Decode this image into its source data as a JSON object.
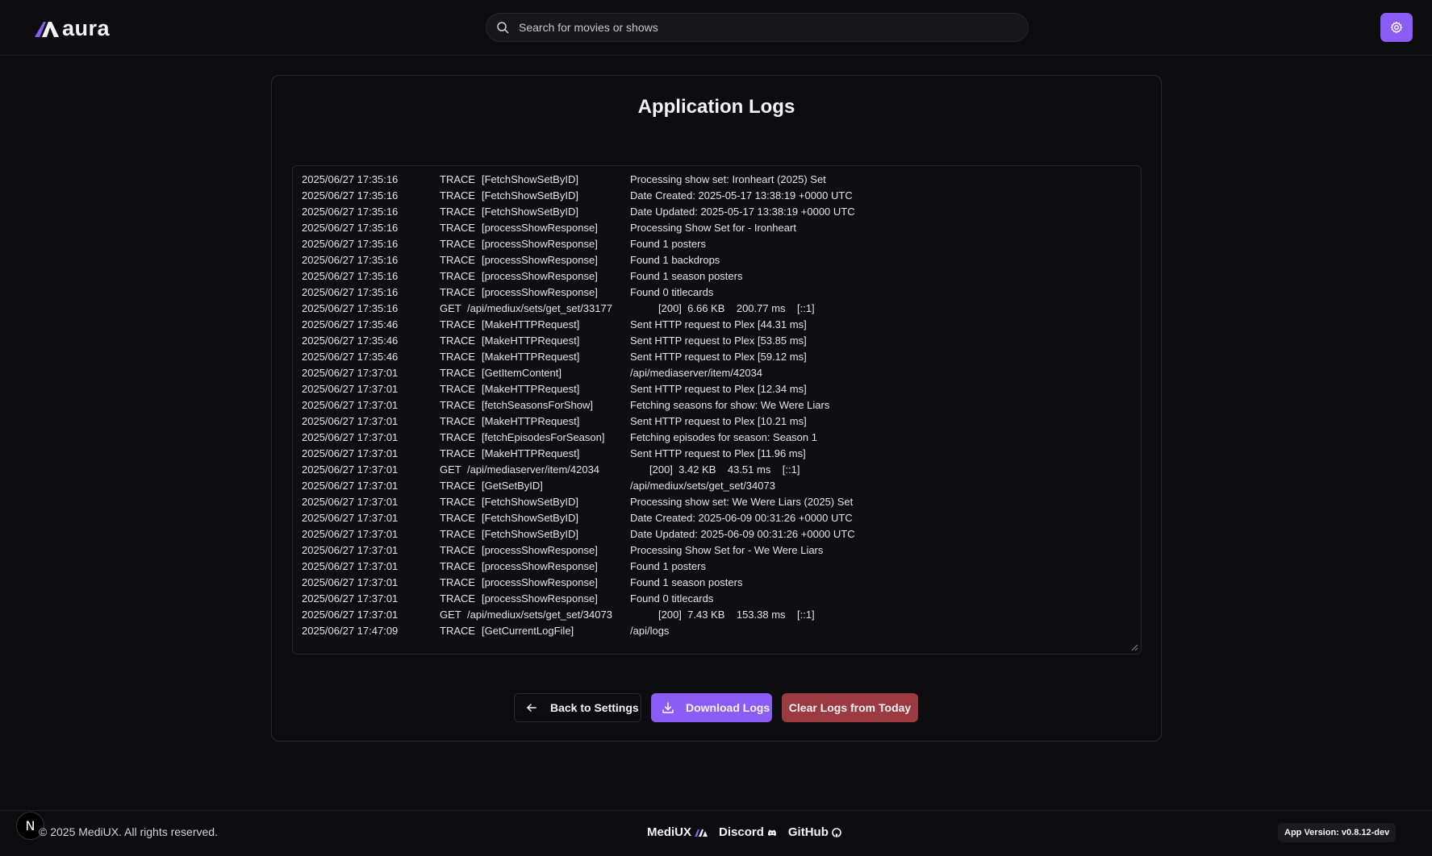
{
  "app": {
    "name": "aura",
    "accent_color": "#8b5cf6",
    "danger_color": "#9b3a40"
  },
  "search": {
    "placeholder": "Search for movies or shows"
  },
  "page": {
    "title": "Application Logs"
  },
  "logs": [
    {
      "ts": "2025/06/27 17:35:16",
      "level": "TRACE",
      "source": "[FetchShowSetByID]",
      "message": "Processing show set: Ironheart (2025) Set"
    },
    {
      "ts": "2025/06/27 17:35:16",
      "level": "TRACE",
      "source": "[FetchShowSetByID]",
      "message": "Date Created: 2025-05-17 13:38:19 +0000 UTC"
    },
    {
      "ts": "2025/06/27 17:35:16",
      "level": "TRACE",
      "source": "[FetchShowSetByID]",
      "message": "Date Updated: 2025-05-17 13:38:19 +0000 UTC"
    },
    {
      "ts": "2025/06/27 17:35:16",
      "level": "TRACE",
      "source": "[processShowResponse]",
      "message": "Processing Show Set for - Ironheart"
    },
    {
      "ts": "2025/06/27 17:35:16",
      "level": "TRACE",
      "source": "[processShowResponse]",
      "message": "Found 1 posters"
    },
    {
      "ts": "2025/06/27 17:35:16",
      "level": "TRACE",
      "source": "[processShowResponse]",
      "message": "Found 1 backdrops"
    },
    {
      "ts": "2025/06/27 17:35:16",
      "level": "TRACE",
      "source": "[processShowResponse]",
      "message": "Found 1 season posters"
    },
    {
      "ts": "2025/06/27 17:35:16",
      "level": "TRACE",
      "source": "[processShowResponse]",
      "message": "Found 0 titlecards"
    },
    {
      "ts": "2025/06/27 17:35:16",
      "level": "GET",
      "source": "/api/mediux/sets/get_set/33177",
      "message": "[200]  6.66 KB    200.77 ms    [::1]"
    },
    {
      "ts": "2025/06/27 17:35:46",
      "level": "TRACE",
      "source": "[MakeHTTPRequest]",
      "message": "Sent HTTP request to Plex [44.31 ms]"
    },
    {
      "ts": "2025/06/27 17:35:46",
      "level": "TRACE",
      "source": "[MakeHTTPRequest]",
      "message": "Sent HTTP request to Plex [53.85 ms]"
    },
    {
      "ts": "2025/06/27 17:35:46",
      "level": "TRACE",
      "source": "[MakeHTTPRequest]",
      "message": "Sent HTTP request to Plex [59.12 ms]"
    },
    {
      "ts": "2025/06/27 17:37:01",
      "level": "TRACE",
      "source": "[GetItemContent]",
      "message": "/api/mediaserver/item/42034"
    },
    {
      "ts": "2025/06/27 17:37:01",
      "level": "TRACE",
      "source": "[MakeHTTPRequest]",
      "message": "Sent HTTP request to Plex [12.34 ms]"
    },
    {
      "ts": "2025/06/27 17:37:01",
      "level": "TRACE",
      "source": "[fetchSeasonsForShow]",
      "message": "Fetching seasons for show: We Were Liars"
    },
    {
      "ts": "2025/06/27 17:37:01",
      "level": "TRACE",
      "source": "[MakeHTTPRequest]",
      "message": "Sent HTTP request to Plex [10.21 ms]"
    },
    {
      "ts": "2025/06/27 17:37:01",
      "level": "TRACE",
      "source": "[fetchEpisodesForSeason]",
      "message": "Fetching episodes for season: Season 1"
    },
    {
      "ts": "2025/06/27 17:37:01",
      "level": "TRACE",
      "source": "[MakeHTTPRequest]",
      "message": "Sent HTTP request to Plex [11.96 ms]"
    },
    {
      "ts": "2025/06/27 17:37:01",
      "level": "GET",
      "source": "/api/mediaserver/item/42034",
      "message": "[200]  3.42 KB    43.51 ms    [::1]"
    },
    {
      "ts": "2025/06/27 17:37:01",
      "level": "TRACE",
      "source": "[GetSetByID]",
      "message": "/api/mediux/sets/get_set/34073"
    },
    {
      "ts": "2025/06/27 17:37:01",
      "level": "TRACE",
      "source": "[FetchShowSetByID]",
      "message": "Processing show set: We Were Liars (2025) Set"
    },
    {
      "ts": "2025/06/27 17:37:01",
      "level": "TRACE",
      "source": "[FetchShowSetByID]",
      "message": "Date Created: 2025-06-09 00:31:26 +0000 UTC"
    },
    {
      "ts": "2025/06/27 17:37:01",
      "level": "TRACE",
      "source": "[FetchShowSetByID]",
      "message": "Date Updated: 2025-06-09 00:31:26 +0000 UTC"
    },
    {
      "ts": "2025/06/27 17:37:01",
      "level": "TRACE",
      "source": "[processShowResponse]",
      "message": "Processing Show Set for - We Were Liars"
    },
    {
      "ts": "2025/06/27 17:37:01",
      "level": "TRACE",
      "source": "[processShowResponse]",
      "message": "Found 1 posters"
    },
    {
      "ts": "2025/06/27 17:37:01",
      "level": "TRACE",
      "source": "[processShowResponse]",
      "message": "Found 1 season posters"
    },
    {
      "ts": "2025/06/27 17:37:01",
      "level": "TRACE",
      "source": "[processShowResponse]",
      "message": "Found 0 titlecards"
    },
    {
      "ts": "2025/06/27 17:37:01",
      "level": "GET",
      "source": "/api/mediux/sets/get_set/34073",
      "message": "[200]  7.43 KB    153.38 ms    [::1]"
    },
    {
      "ts": "2025/06/27 17:47:09",
      "level": "TRACE",
      "source": "[GetCurrentLogFile]",
      "message": "/api/logs"
    }
  ],
  "buttons": {
    "back": "Back to Settings",
    "download": "Download Logs",
    "clear": "Clear Logs from Today"
  },
  "footer": {
    "badge": "N",
    "copyright": "© 2025 MediUX. All rights reserved.",
    "links": [
      {
        "label": "MediUX",
        "icon": "mediux-icon"
      },
      {
        "label": "Discord",
        "icon": "discord-icon"
      },
      {
        "label": "GitHub",
        "icon": "github-icon"
      }
    ],
    "version": "App Version: v0.8.12-dev"
  }
}
